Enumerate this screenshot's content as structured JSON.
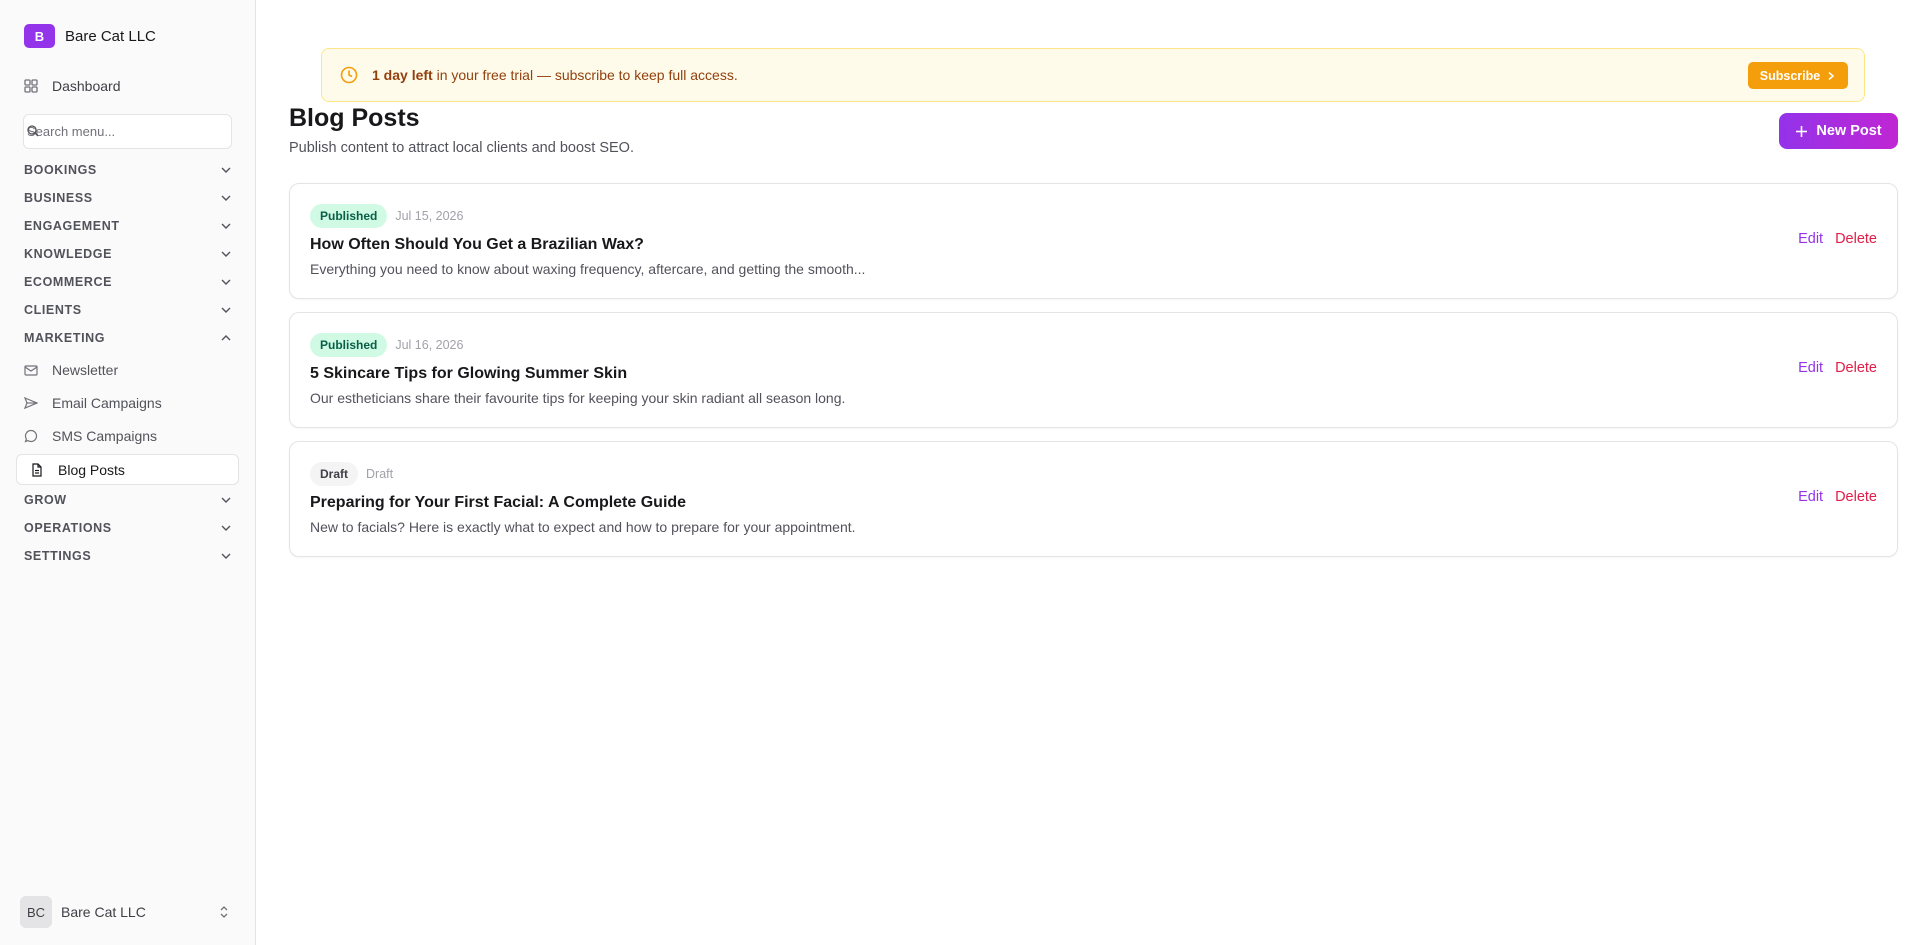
{
  "brand": {
    "initial": "B",
    "name": "Bare Cat LLC"
  },
  "sidebar": {
    "dashboard_label": "Dashboard",
    "search_placeholder": "Search menu...",
    "sections": [
      {
        "label": "BOOKINGS"
      },
      {
        "label": "BUSINESS"
      },
      {
        "label": "ENGAGEMENT"
      },
      {
        "label": "KNOWLEDGE"
      },
      {
        "label": "ECOMMERCE"
      },
      {
        "label": "CLIENTS"
      },
      {
        "label": "MARKETING"
      },
      {
        "label": "GROW"
      },
      {
        "label": "OPERATIONS"
      },
      {
        "label": "SETTINGS"
      }
    ],
    "marketing_items": [
      {
        "label": "Newsletter",
        "icon": "mail-icon"
      },
      {
        "label": "Email Campaigns",
        "icon": "send-icon"
      },
      {
        "label": "SMS Campaigns",
        "icon": "message-circle-icon"
      },
      {
        "label": "Blog Posts",
        "icon": "file-text-icon",
        "active": true
      }
    ],
    "account": {
      "initials": "BC",
      "name": "Bare Cat LLC"
    }
  },
  "banner": {
    "bold": "1 day left",
    "text": " in your free trial — subscribe to keep full access.",
    "button_label": "Subscribe"
  },
  "page": {
    "title": "Blog Posts",
    "subtitle": "Publish content to attract local clients and boost SEO.",
    "new_post_label": "New Post"
  },
  "posts": [
    {
      "status": "Published",
      "date": "Jul 15, 2026",
      "title": "How Often Should You Get a Brazilian Wax?",
      "excerpt": "Everything you need to know about waxing frequency, aftercare, and getting the smooth..."
    },
    {
      "status": "Published",
      "date": "Jul 16, 2026",
      "title": "5 Skincare Tips for Glowing Summer Skin",
      "excerpt": "Our estheticians share their favourite tips for keeping your skin radiant all season long."
    },
    {
      "status": "Draft",
      "date": "Draft",
      "title": "Preparing for Your First Facial: A Complete Guide",
      "excerpt": "New to facials? Here is exactly what to expect and how to prepare for your appointment."
    }
  ],
  "actions": {
    "edit_label": "Edit",
    "delete_label": "Delete"
  },
  "colors": {
    "accent": "#9333ea",
    "published_badge_bg": "#d1fae5",
    "published_badge_text": "#065f46",
    "banner_bg": "#fffbeb",
    "subscribe_button": "#f59e0b",
    "delete": "#e11d48"
  }
}
